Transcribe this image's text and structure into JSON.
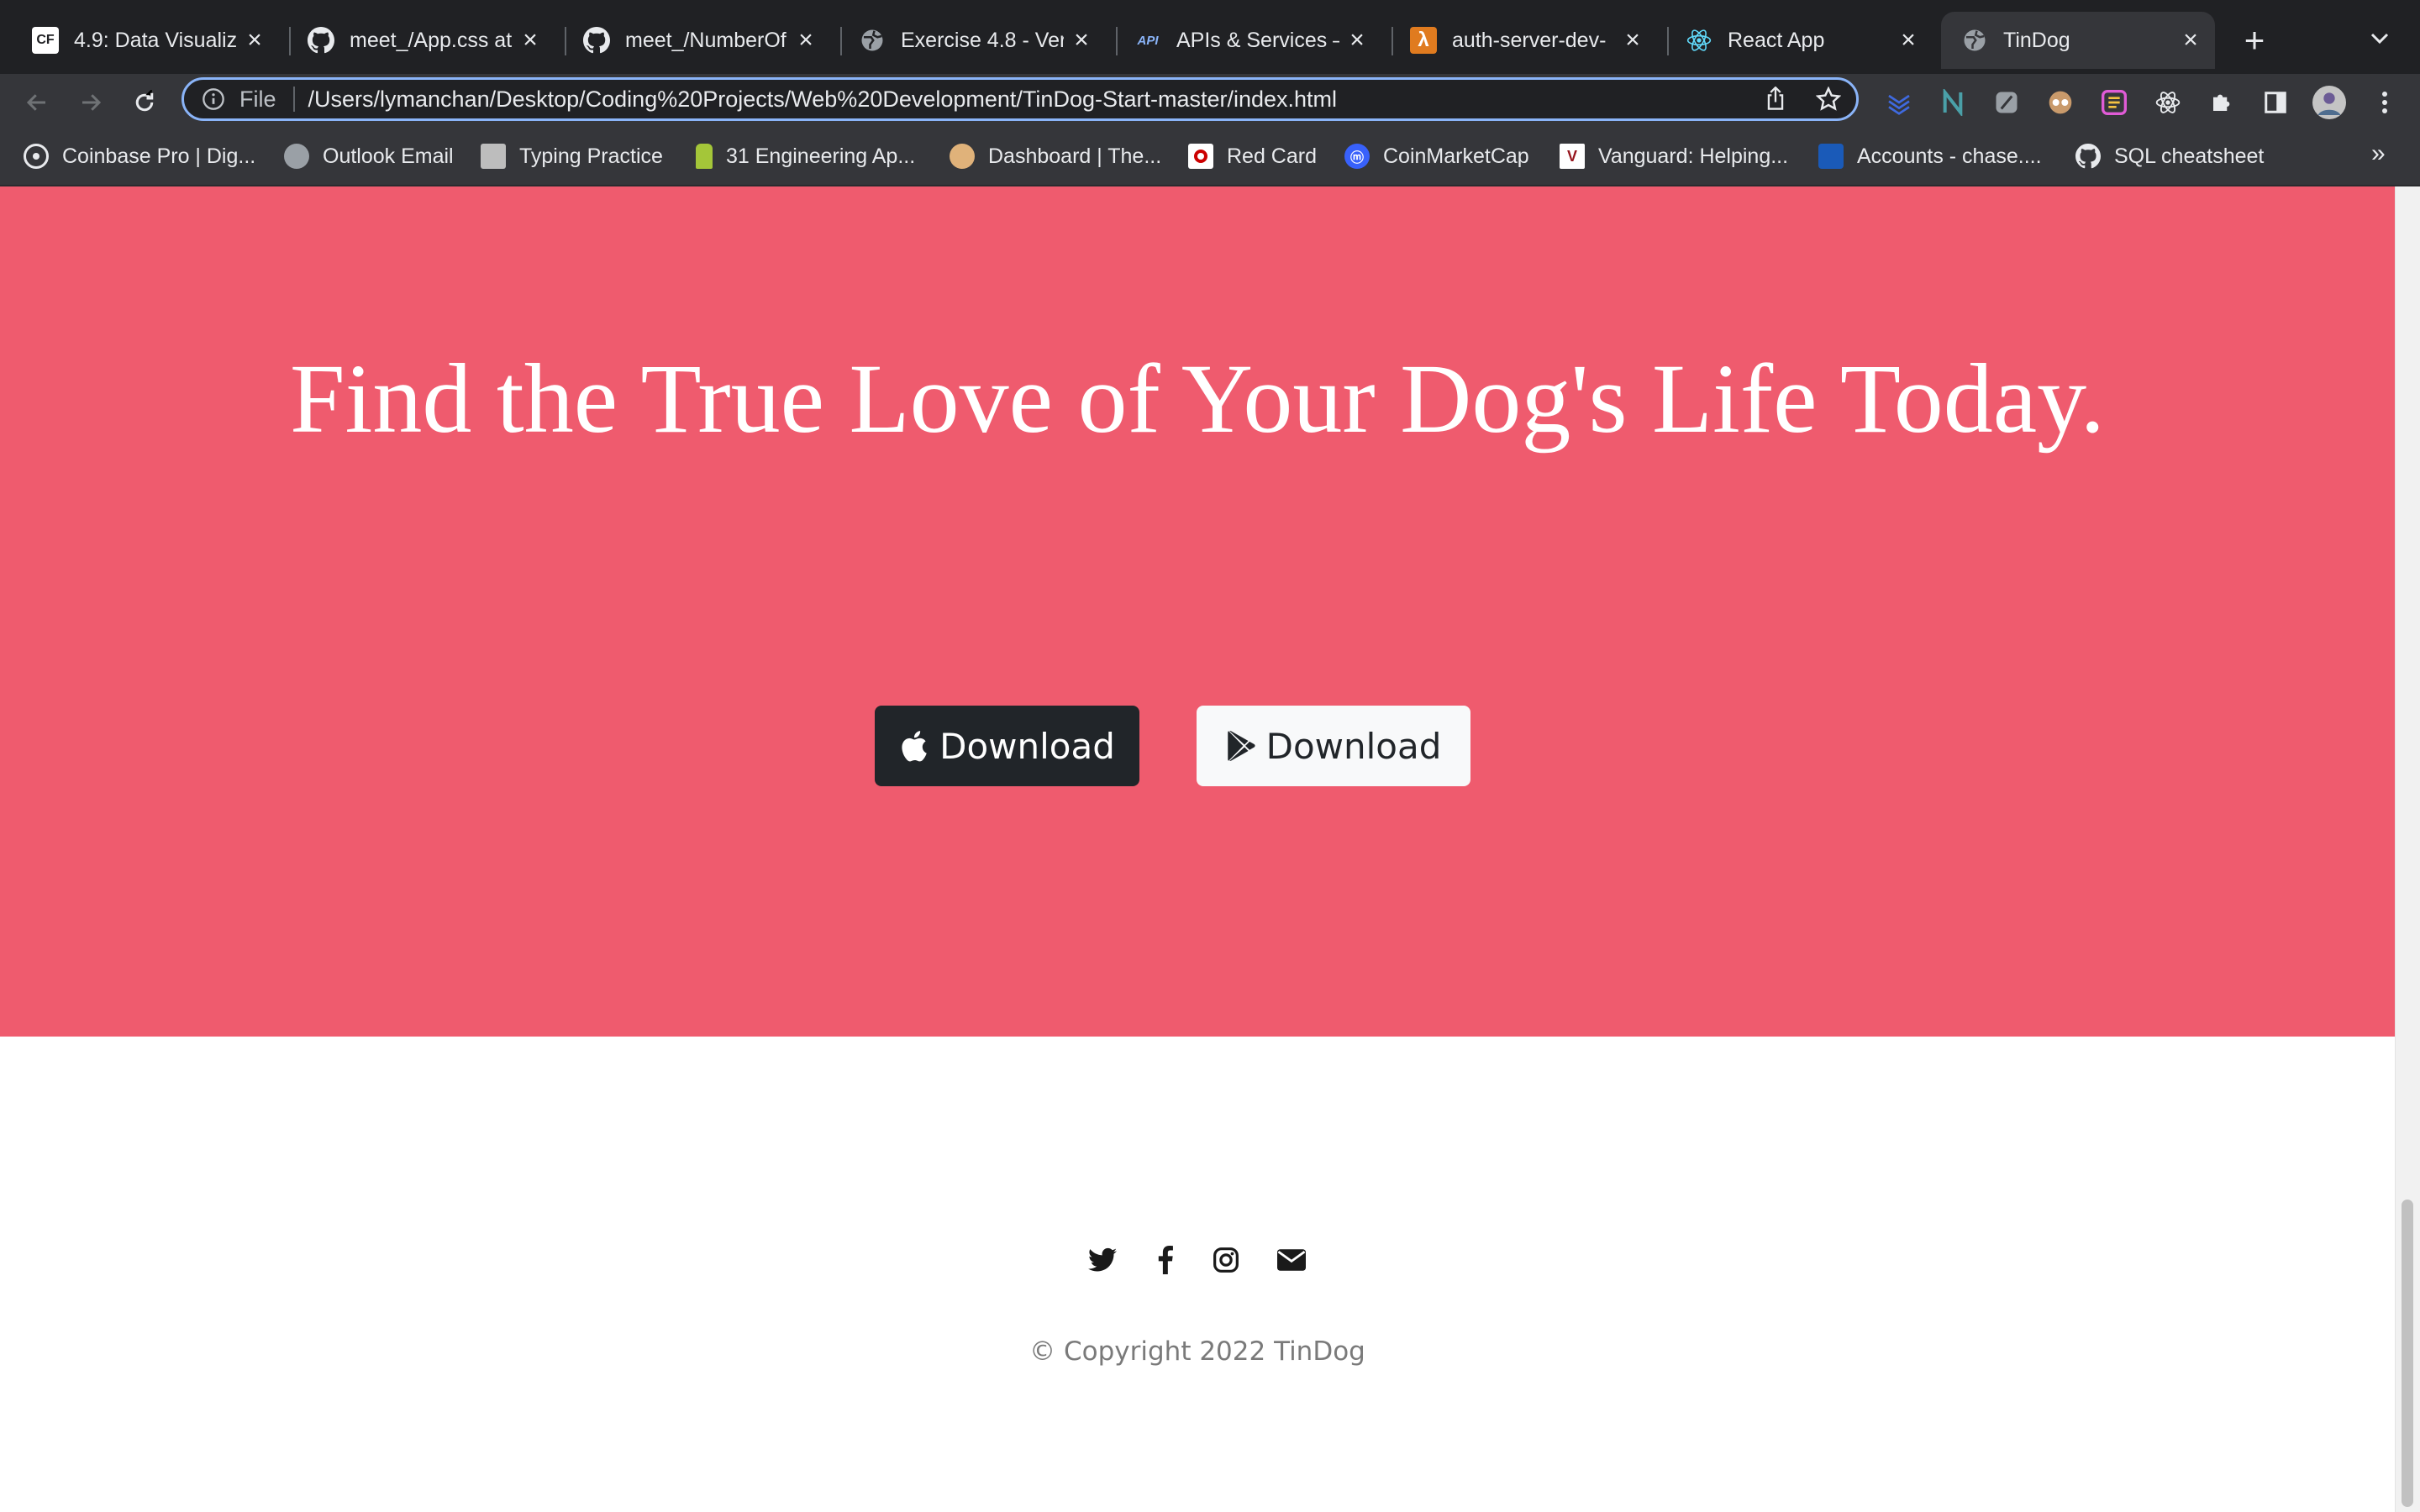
{
  "browser": {
    "tabs": [
      {
        "title": "4.9: Data Visualiz",
        "icon": "cf-logo",
        "favicon_text": "CF"
      },
      {
        "title": "meet_/App.css at",
        "icon": "github-icon"
      },
      {
        "title": "meet_/NumberOf",
        "icon": "github-icon"
      },
      {
        "title": "Exercise 4.8 - Ver",
        "icon": "globe-icon"
      },
      {
        "title": "APIs & Services –",
        "icon": "api-icon",
        "favicon_text": "API"
      },
      {
        "title": "auth-server-dev-",
        "icon": "aws-lambda-icon",
        "favicon_text": "λ"
      },
      {
        "title": "React App",
        "icon": "react-icon"
      },
      {
        "title": "TinDog",
        "icon": "globe-icon",
        "active": true
      }
    ],
    "address": {
      "scheme_label": "File",
      "url": "/Users/lymanchan/Desktop/Coding%20Projects/Web%20Development/TinDog-Start-master/index.html"
    },
    "bookmarks": [
      {
        "label": "Coinbase Pro | Dig...",
        "icon": "coinbase-icon"
      },
      {
        "label": "Outlook Email",
        "icon": "globe-icon"
      },
      {
        "label": "Typing Practice",
        "icon": "keyboard-icon"
      },
      {
        "label": "31 Engineering Ap...",
        "icon": "android-icon"
      },
      {
        "label": "Dashboard | The...",
        "icon": "viking-icon"
      },
      {
        "label": "Red Card",
        "icon": "target-icon"
      },
      {
        "label": "CoinMarketCap",
        "icon": "coinmarketcap-icon"
      },
      {
        "label": "Vanguard: Helping...",
        "icon": "vanguard-icon",
        "favicon_text": "V"
      },
      {
        "label": "Accounts - chase....",
        "icon": "chase-icon"
      },
      {
        "label": "SQL cheatsheet",
        "icon": "github-icon"
      }
    ],
    "bookmarks_overflow": "»"
  },
  "page": {
    "hero": {
      "headline": "Find the True Love of Your Dog's Life Today.",
      "background_color": "#ef5b6e",
      "buttons": [
        {
          "label": "Download",
          "icon": "apple-icon",
          "style": "dark"
        },
        {
          "label": "Download",
          "icon": "google-play-icon",
          "style": "light"
        }
      ]
    },
    "footer": {
      "social_icons": [
        "twitter-icon",
        "facebook-icon",
        "instagram-icon",
        "envelope-icon"
      ],
      "copyright": "© Copyright 2022 TinDog"
    }
  },
  "colors": {
    "hero_bg": "#ef5b6e",
    "chrome_dark": "#202124",
    "chrome_toolbar": "#35363a",
    "focus_ring": "#8ab4f8"
  }
}
